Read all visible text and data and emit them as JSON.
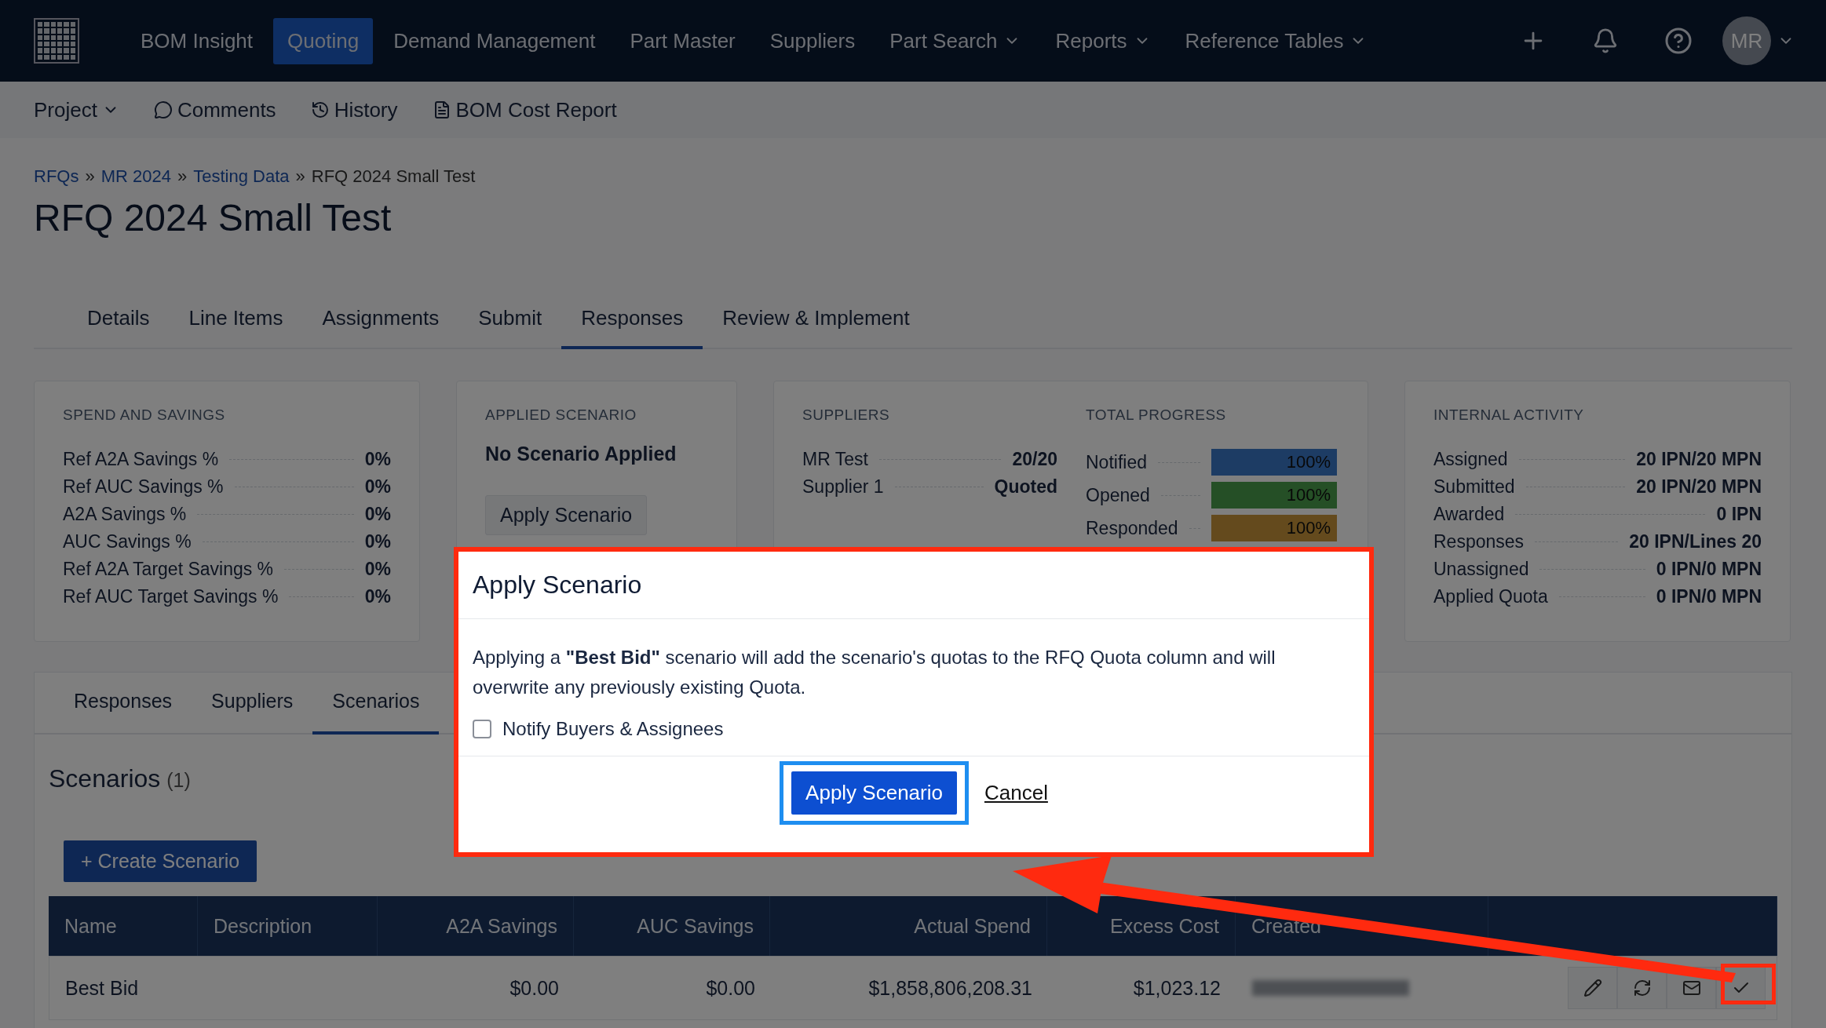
{
  "top_nav": {
    "items": [
      {
        "label": "BOM Insight",
        "selected": false,
        "dropdown": false
      },
      {
        "label": "Quoting",
        "selected": true,
        "dropdown": false
      },
      {
        "label": "Demand Management",
        "selected": false,
        "dropdown": false
      },
      {
        "label": "Part Master",
        "selected": false,
        "dropdown": false
      },
      {
        "label": "Suppliers",
        "selected": false,
        "dropdown": false
      },
      {
        "label": "Part Search",
        "selected": false,
        "dropdown": true
      },
      {
        "label": "Reports",
        "selected": false,
        "dropdown": true
      },
      {
        "label": "Reference Tables",
        "selected": false,
        "dropdown": true
      }
    ],
    "avatar": "MR"
  },
  "sub_nav": [
    {
      "label": "Project",
      "kind": "dropdown"
    },
    {
      "label": "Comments",
      "kind": "comments"
    },
    {
      "label": "History",
      "kind": "history"
    },
    {
      "label": "BOM Cost Report",
      "kind": "report"
    }
  ],
  "breadcrumb": {
    "links": [
      "RFQs",
      "MR 2024",
      "Testing Data"
    ],
    "separator": "»",
    "current": "RFQ 2024 Small Test"
  },
  "title": "RFQ 2024 Small Test",
  "tabs": [
    {
      "label": "Details",
      "selected": false
    },
    {
      "label": "Line Items",
      "selected": false
    },
    {
      "label": "Assignments",
      "selected": false
    },
    {
      "label": "Submit",
      "selected": false
    },
    {
      "label": "Responses",
      "selected": true
    },
    {
      "label": "Review & Implement",
      "selected": false
    }
  ],
  "spend_and_savings": {
    "heading": "SPEND AND SAVINGS",
    "rows": [
      {
        "label": "Ref A2A Savings %",
        "value": "0%"
      },
      {
        "label": "Ref AUC Savings %",
        "value": "0%"
      },
      {
        "label": "A2A Savings %",
        "value": "0%"
      },
      {
        "label": "AUC Savings %",
        "value": "0%"
      },
      {
        "label": "Ref A2A Target Savings %",
        "value": "0%"
      },
      {
        "label": "Ref AUC Target Savings %",
        "value": "0%"
      }
    ]
  },
  "applied_scenario": {
    "heading": "APPLIED SCENARIO",
    "status": "No Scenario Applied",
    "button": "Apply Scenario"
  },
  "suppliers": {
    "heading": "SUPPLIERS",
    "rows": [
      {
        "label": "MR Test",
        "value": "20/20"
      },
      {
        "label": "Supplier 1",
        "value": "Quoted"
      }
    ]
  },
  "total_progress": {
    "heading": "TOTAL PROGRESS",
    "rows": [
      {
        "label": "Notified",
        "level": 1,
        "reading": "100%",
        "kind": "notified"
      },
      {
        "label": "Opened",
        "level": 1,
        "reading": "100%",
        "kind": "opened"
      },
      {
        "label": "Responded",
        "level": 1,
        "reading": "100%",
        "kind": "responded"
      }
    ]
  },
  "internal_activity": {
    "heading": "INTERNAL ACTIVITY",
    "rows": [
      {
        "label": "Assigned",
        "value": "20 IPN/20 MPN"
      },
      {
        "label": "Submitted",
        "value": "20 IPN/20 MPN"
      },
      {
        "label": "Awarded",
        "value": "0 IPN"
      },
      {
        "label": "Responses",
        "value": "20 IPN/Lines 20"
      },
      {
        "label": "Unassigned",
        "value": "0 IPN/0 MPN"
      },
      {
        "label": "Applied Quota",
        "value": "0 IPN/0 MPN"
      }
    ]
  },
  "lower_tabs": [
    {
      "label": "Responses",
      "selected": false
    },
    {
      "label": "Suppliers",
      "selected": false
    },
    {
      "label": "Scenarios",
      "selected": true
    }
  ],
  "scenarios": {
    "heading": "Scenarios",
    "count": "(1)",
    "create_button": "+ Create Scenario",
    "table": {
      "columns": [
        "Name",
        "Description",
        "A2A Savings",
        "AUC Savings",
        "Actual Spend",
        "Excess Cost",
        "Created"
      ],
      "rows": [
        {
          "cells": [
            "Best Bid",
            "",
            "$0.00",
            "$0.00",
            "$1,858,806,208.31",
            "$1,023.12"
          ],
          "created_by_redacted": true
        }
      ]
    }
  },
  "modal": {
    "title": "Apply Scenario",
    "message": "Applying a **\"Best Bid\"** scenario will add the scenario's quotas to the RFQ Quota column and will overwrite any previously existing Quota.",
    "checkbox": {
      "label": "Notify Buyers & Assignees",
      "checked": false
    },
    "confirm": "Apply Scenario",
    "cancel": "Cancel"
  }
}
